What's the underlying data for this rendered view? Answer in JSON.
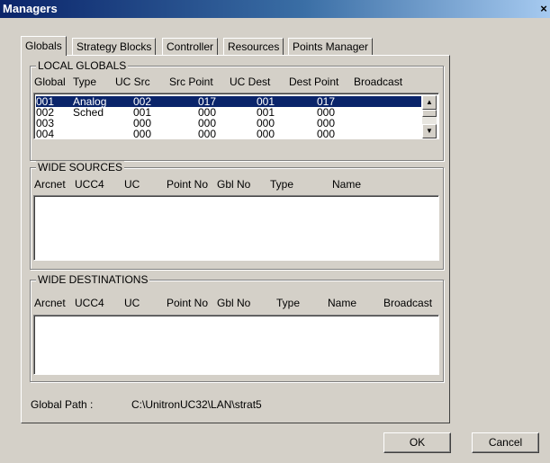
{
  "window": {
    "title": "Managers",
    "close_glyph": "×"
  },
  "tabs": [
    {
      "label": "Globals",
      "active": true
    },
    {
      "label": "Strategy Blocks",
      "active": false
    },
    {
      "label": "Controller",
      "active": false
    },
    {
      "label": "Resources",
      "active": false
    },
    {
      "label": "Points Manager",
      "active": false
    }
  ],
  "local_globals": {
    "title": "LOCAL GLOBALS",
    "columns": [
      "Global",
      "Type",
      "UC Src",
      "Src Point",
      "UC Dest",
      "Dest Point",
      "Broadcast"
    ],
    "rows": [
      {
        "global": "001",
        "type": "Analog",
        "uc_src": "002",
        "src_point": "017",
        "uc_dest": "001",
        "dest_point": "017",
        "broadcast": "",
        "selected": true
      },
      {
        "global": "002",
        "type": "Sched",
        "uc_src": "001",
        "src_point": "000",
        "uc_dest": "001",
        "dest_point": "000",
        "broadcast": "",
        "selected": false
      },
      {
        "global": "003",
        "type": "",
        "uc_src": "000",
        "src_point": "000",
        "uc_dest": "000",
        "dest_point": "000",
        "broadcast": "",
        "selected": false
      },
      {
        "global": "004",
        "type": "",
        "uc_src": "000",
        "src_point": "000",
        "uc_dest": "000",
        "dest_point": "000",
        "broadcast": "",
        "selected": false
      }
    ]
  },
  "wide_sources": {
    "title": "WIDE SOURCES",
    "columns": [
      "Arcnet",
      "UCC4",
      "UC",
      "Point No",
      "Gbl No",
      "Type",
      "Name"
    ]
  },
  "wide_destinations": {
    "title": "WIDE DESTINATIONS",
    "columns": [
      "Arcnet",
      "UCC4",
      "UC",
      "Point No",
      "Gbl No",
      "Type",
      "Name",
      "Broadcast"
    ]
  },
  "global_path": {
    "label": "Global Path :",
    "value": "C:\\UnitronUC32\\LAN\\strat5"
  },
  "buttons": {
    "ok": "OK",
    "cancel": "Cancel"
  }
}
